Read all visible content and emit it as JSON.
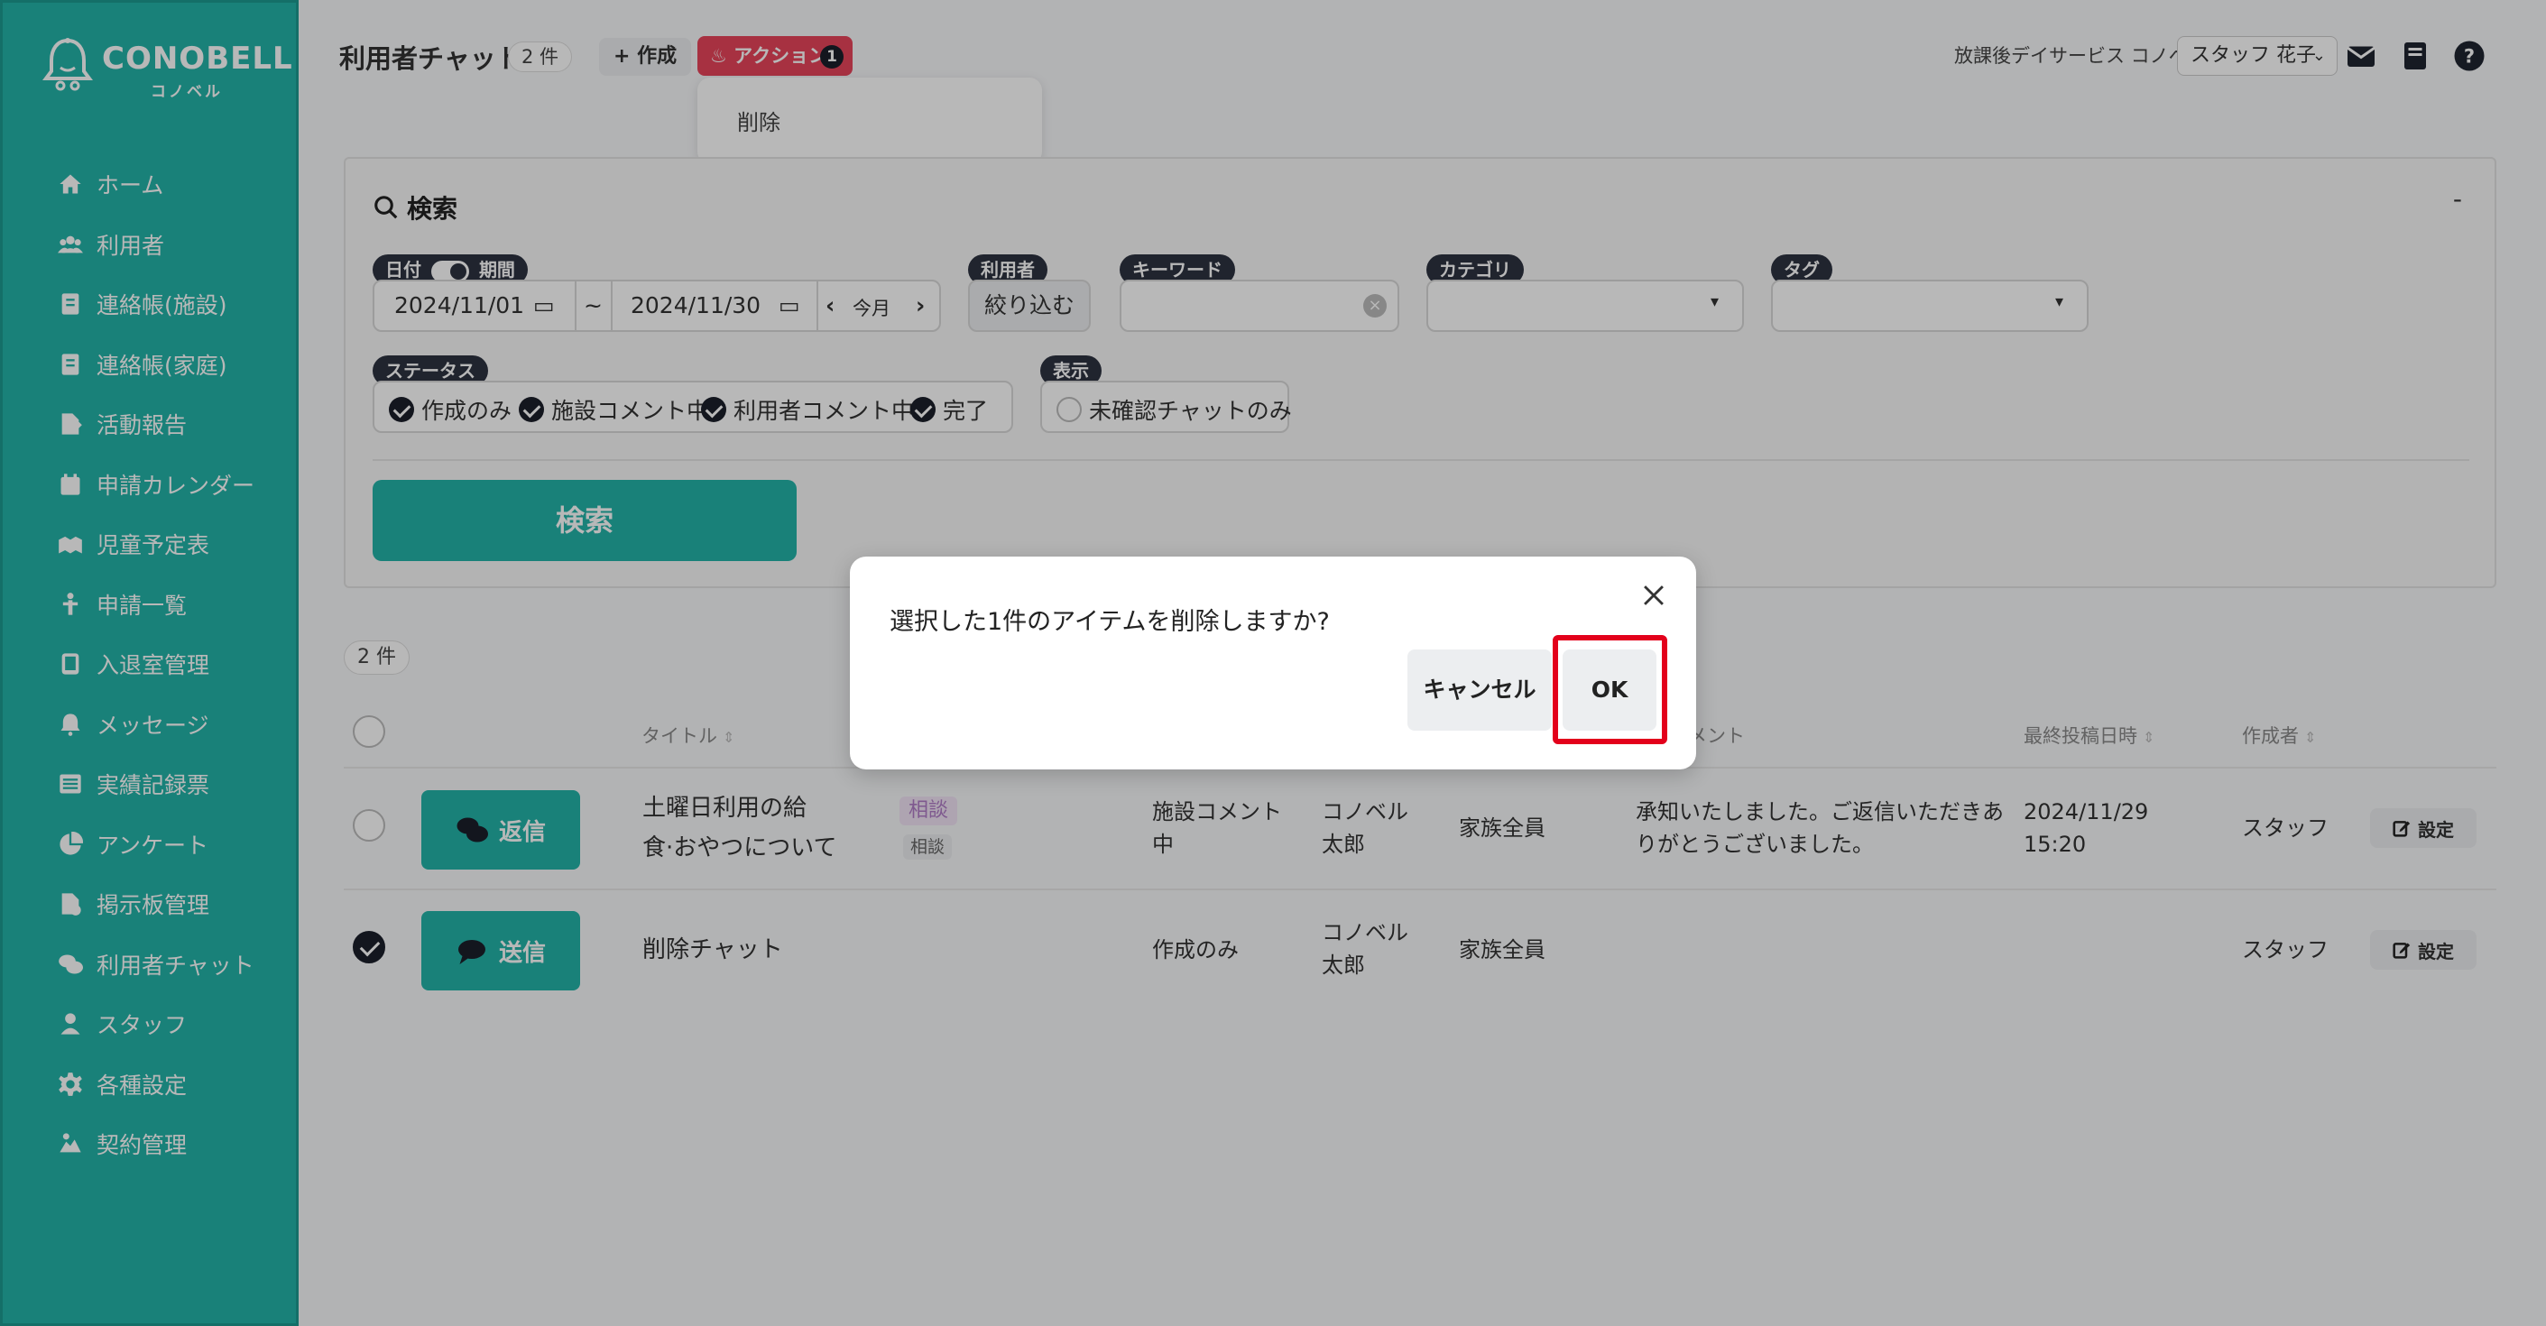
{
  "app": {
    "brand": "CONOBELL",
    "brand_sub": "コノベル"
  },
  "sidebar": {
    "items": [
      {
        "label": "ホーム",
        "icon": "home-icon"
      },
      {
        "label": "利用者",
        "icon": "users-icon"
      },
      {
        "label": "連絡帳(施設)",
        "icon": "contact-book-icon"
      },
      {
        "label": "連絡帳(家庭)",
        "icon": "contact-book-icon"
      },
      {
        "label": "活動報告",
        "icon": "report-icon"
      },
      {
        "label": "申請カレンダー",
        "icon": "calendar-icon"
      },
      {
        "label": "児童予定表",
        "icon": "schedule-icon"
      },
      {
        "label": "申請一覧",
        "icon": "request-icon"
      },
      {
        "label": "入退室管理",
        "icon": "tablet-icon"
      },
      {
        "label": "メッセージ",
        "icon": "bell-icon"
      },
      {
        "label": "実績記録票",
        "icon": "table-icon"
      },
      {
        "label": "アンケート",
        "icon": "pie-chart-icon"
      },
      {
        "label": "掲示板管理",
        "icon": "board-icon"
      },
      {
        "label": "利用者チャット",
        "icon": "chat-icon"
      },
      {
        "label": "スタッフ",
        "icon": "staff-icon"
      },
      {
        "label": "各種設定",
        "icon": "gear-icon"
      },
      {
        "label": "契約管理",
        "icon": "contract-icon"
      }
    ]
  },
  "header": {
    "title": "利用者チャット",
    "count": "2 件",
    "create_label": "+ 作成",
    "action_label": "アクション",
    "action_badge": "1",
    "dropdown_item": "削除",
    "facility": "放課後デイサービス コノベル",
    "staff": "スタッフ 花子"
  },
  "search": {
    "title": "検索",
    "collapse": "-",
    "date_label_a": "日付",
    "date_label_b": "期間",
    "date_from": "2024/11/01",
    "date_sep": "~",
    "date_to": "2024/11/30",
    "month_label": "今月",
    "user_label": "利用者",
    "user_button": "絞り込む",
    "keyword_label": "キーワード",
    "category_label": "カテゴリ",
    "tag_label": "タグ",
    "status_label": "ステータス",
    "status_options": [
      "作成のみ",
      "施設コメント中",
      "利用者コメント中",
      "完了"
    ],
    "display_label": "表示",
    "display_option": "未確認チャットのみ",
    "search_button": "検索"
  },
  "table": {
    "count": "2 件",
    "headers": {
      "title": "タイトル",
      "comment": "メント",
      "last_post": "最終投稿日時",
      "author": "作成者"
    },
    "rows": [
      {
        "button": "返信",
        "title_line1": "土曜日利用の給",
        "title_line2": "食·おやつについて",
        "category": "相談",
        "tag": "相談",
        "status_line1": "施設コメント",
        "status_line2": "中",
        "user_line1": "コノベル",
        "user_line2": "太郎",
        "target": "家族全員",
        "comment_line1": "承知いたしました。ご返信いただきあ",
        "comment_line2": "りがとうございました。",
        "date_line1": "2024/11/29",
        "date_line2": "15:20",
        "author": "スタッフ",
        "settings": "設定",
        "checked": false
      },
      {
        "button": "送信",
        "title_line1": "削除チャット",
        "status_line1": "作成のみ",
        "user_line1": "コノベル",
        "user_line2": "太郎",
        "target": "家族全員",
        "author": "スタッフ",
        "settings": "設定",
        "checked": true
      }
    ]
  },
  "modal": {
    "message": "選択した1件のアイテムを削除しますか?",
    "cancel": "キャンセル",
    "ok": "OK"
  },
  "colors": {
    "brand": "#23b3a8",
    "action": "#e8445b",
    "highlight": "#e3001b"
  }
}
